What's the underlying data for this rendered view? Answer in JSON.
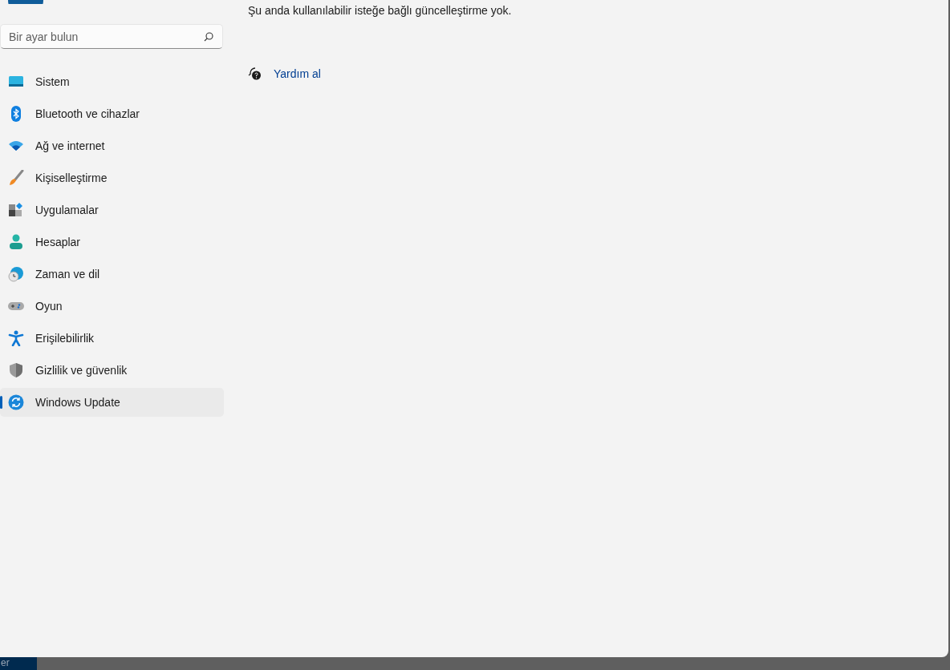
{
  "search": {
    "placeholder": "Bir ayar bulun"
  },
  "sidebar": {
    "items": [
      {
        "label": "Sistem",
        "selected": false
      },
      {
        "label": "Bluetooth ve cihazlar",
        "selected": false
      },
      {
        "label": "Ağ ve internet",
        "selected": false
      },
      {
        "label": "Kişiselleştirme",
        "selected": false
      },
      {
        "label": "Uygulamalar",
        "selected": false
      },
      {
        "label": "Hesaplar",
        "selected": false
      },
      {
        "label": "Zaman ve dil",
        "selected": false
      },
      {
        "label": "Oyun",
        "selected": false
      },
      {
        "label": "Erişilebilirlik",
        "selected": false
      },
      {
        "label": "Gizlilik ve güvenlik",
        "selected": false
      },
      {
        "label": "Windows Update",
        "selected": true
      }
    ]
  },
  "content": {
    "message": "Şu anda kullanılabilir isteğe bağlı güncelleştirme yok.",
    "help_link": "Yardım al"
  },
  "taskbar": {
    "button_text": "er"
  }
}
